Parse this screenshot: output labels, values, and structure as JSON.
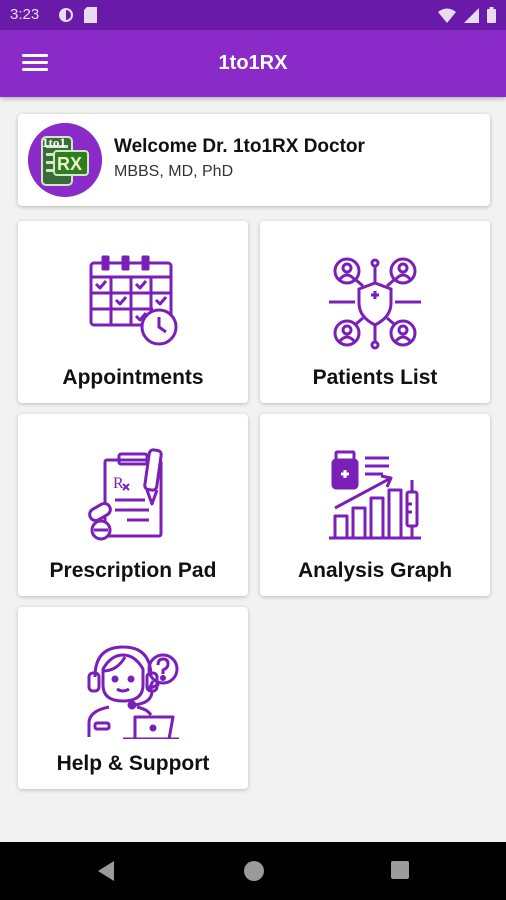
{
  "status_bar": {
    "time": "3:23"
  },
  "app_bar": {
    "title": "1to1RX"
  },
  "welcome": {
    "greeting": "Welcome Dr. 1to1RX Doctor",
    "degrees": "MBBS, MD, PhD",
    "logo_text_top": "1to1",
    "logo_text_bottom": "RX"
  },
  "tiles": [
    {
      "label": "Appointments",
      "icon": "calendar-clock-icon"
    },
    {
      "label": "Patients List",
      "icon": "patients-network-icon"
    },
    {
      "label": "Prescription Pad",
      "icon": "prescription-icon"
    },
    {
      "label": "Analysis Graph",
      "icon": "analysis-graph-icon"
    },
    {
      "label": "Help & Support",
      "icon": "support-agent-icon"
    }
  ],
  "colors": {
    "primary": "#8a2bc9",
    "status": "#6a1aa8",
    "icon": "#7a1fb8"
  }
}
